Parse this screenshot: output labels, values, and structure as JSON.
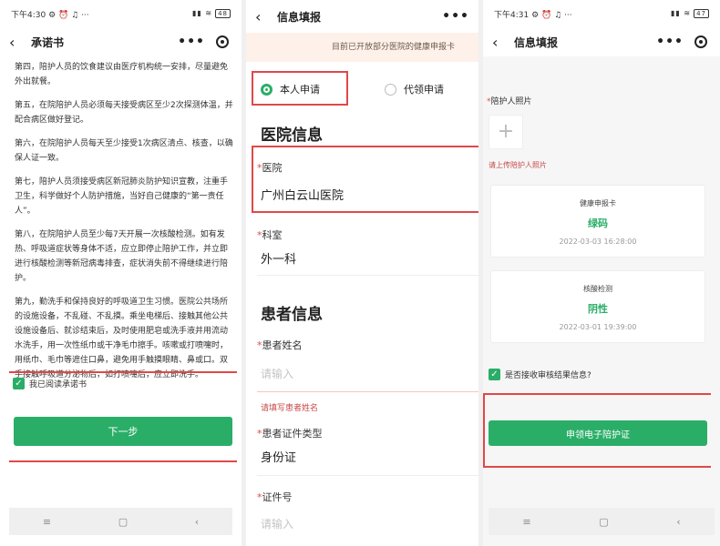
{
  "screen1": {
    "status_time": "下午4:30",
    "status_icons": "⚙ ⏰ ♫ ···",
    "status_right": "▮▮ ≋",
    "battery": "48",
    "title": "承诺书",
    "paragraphs": [
      "第四，陪护人员的饮食建议由医疗机构统一安排，尽量避免外出就餐。",
      "第五，在院陪护人员必须每天接受病区至少2次探测体温，并配合病区做好登记。",
      "第六，在院陪护人员每天至少接受1次病区清点、核查，以确保人证一致。",
      "第七，陪护人员须接受病区新冠肺炎防护知识宣教，注重手卫生，科学做好个人防护措施，当好自己健康的“第一责任人”。",
      "第八，在院陪护人员至少每7天开展一次核酸检测。如有发热、呼吸道症状等身体不适，应立即停止陪护工作，并立即进行核酸检测等新冠病毒排查，症状消失前不得继续进行陪护。",
      "第九，勤洗手和保持良好的呼吸道卫生习惯。医院公共场所的设施设备，不乱碰、不乱摸。乘坐电梯后、接触其他公共设施设备后、就诊结束后，及时使用肥皂或洗手液并用流动水洗手，用一次性纸巾或干净毛巾擦手。咳嗽或打喷嚏时，用纸巾、毛巾等遮住口鼻，避免用手触摸眼睛、鼻或口。双手接触呼吸道分泌物后，如打喷嚏后，应立即洗手。"
    ],
    "agree_label": "我已阅读承诺书",
    "next_button": "下一步"
  },
  "screen2": {
    "title": "信息填报",
    "notice": "目前已开放部分医院的健康申报卡",
    "radio_self": "本人申请",
    "radio_proxy": "代领申请",
    "hospital_section": "医院信息",
    "hospital_label": "医院",
    "hospital_value": "广州白云山医院",
    "dept_label": "科室",
    "dept_value": "外一科",
    "patient_section": "患者信息",
    "patient_name_label": "患者姓名",
    "patient_name_placeholder": "请输入",
    "patient_name_error": "请填写患者姓名",
    "id_type_label": "患者证件类型",
    "id_type_value": "身份证",
    "id_no_label": "证件号",
    "id_no_placeholder": "请输入"
  },
  "screen3": {
    "status_time": "下午4:31",
    "battery": "47",
    "title": "信息填报",
    "photo_label": "陪护人照片",
    "photo_error": "请上传陪护人照片",
    "card1": {
      "title": "健康申报卡",
      "value": "绿码",
      "date": "2022-03-03 16:28:00"
    },
    "card2": {
      "title": "核酸检测",
      "value": "阴性",
      "date": "2022-03-01 19:39:00"
    },
    "notify_label": "是否接收审核结果信息?",
    "apply_button": "申领电子陪护证"
  },
  "sysbar": {
    "menu": "≡",
    "home": "▢",
    "back": "‹"
  },
  "colors": {
    "accent": "#2aae67",
    "highlight": "#e04848"
  }
}
